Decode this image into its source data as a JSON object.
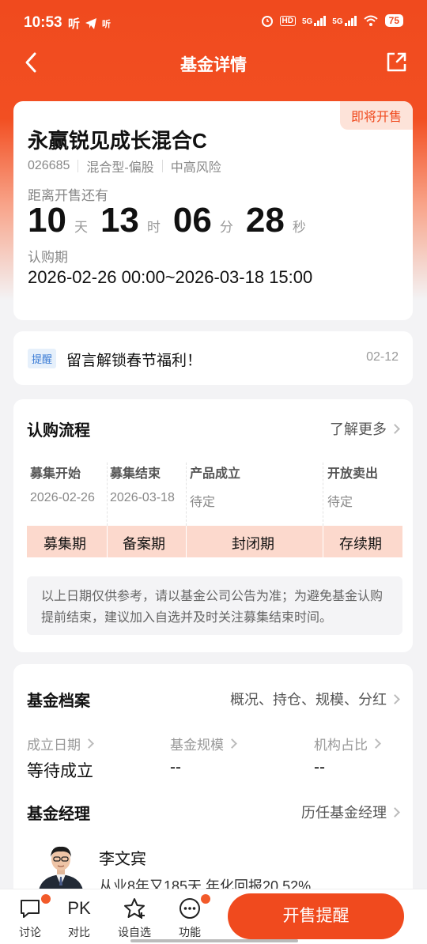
{
  "status_bar": {
    "time": "10:53",
    "left_icons": [
      "听",
      "听"
    ],
    "right_labels": [
      "HD",
      "5G",
      "5G"
    ],
    "battery": "75"
  },
  "nav": {
    "title": "基金详情"
  },
  "fund": {
    "badge": "即将开售",
    "name": "永赢锐见成长混合C",
    "code": "026685",
    "type": "混合型-偏股",
    "risk": "中高风险",
    "countdown_label": "距离开售还有",
    "countdown": [
      {
        "value": "10",
        "unit": "天"
      },
      {
        "value": "13",
        "unit": "时"
      },
      {
        "value": "06",
        "unit": "分"
      },
      {
        "value": "28",
        "unit": "秒"
      }
    ],
    "period_label": "认购期",
    "period_value": "2026-02-26 00:00~2026-03-18 15:00"
  },
  "notice": {
    "tag": "提醒",
    "text": "留言解锁春节福利！",
    "date": "02-12"
  },
  "flow": {
    "title": "认购流程",
    "link": "了解更多",
    "columns": [
      {
        "head": "募集开始",
        "value": "2026-02-26"
      },
      {
        "head": "募集结束",
        "value": "2026-03-18"
      },
      {
        "head": "产品成立",
        "value": "待定"
      },
      {
        "head": "开放卖出",
        "value": "待定"
      }
    ],
    "phases": [
      "募集期",
      "备案期",
      "封闭期",
      "存续期"
    ],
    "disclaimer": "以上日期仅供参考，请以基金公司公告为准；为避免基金认购提前结束，建议加入自选并及时关注募集结束时间。"
  },
  "archive": {
    "title": "基金档案",
    "link": "概况、持仓、规模、分红",
    "metrics": [
      {
        "label": "成立日期",
        "value": "等待成立"
      },
      {
        "label": "基金规模",
        "value": "--"
      },
      {
        "label": "机构占比",
        "value": "--"
      }
    ],
    "manager_title": "基金经理",
    "manager_link": "历任基金经理",
    "manager_name": "李文宾",
    "manager_desc": "从业8年又185天 年化回报20.52%"
  },
  "bottom": {
    "tabs": [
      {
        "label": "讨论",
        "icon": "chat-icon"
      },
      {
        "label": "对比",
        "icon": "pk-icon",
        "glyph": "PK"
      },
      {
        "label": "设自选",
        "icon": "star-plus-icon"
      },
      {
        "label": "功能",
        "icon": "more-icon"
      }
    ],
    "cta": "开售提醒"
  }
}
